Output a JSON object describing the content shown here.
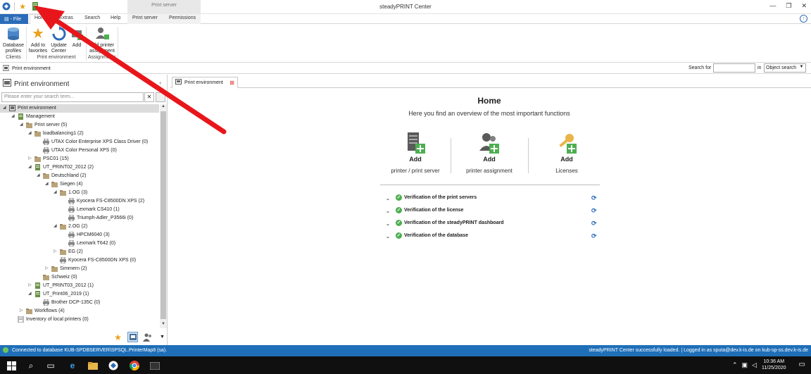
{
  "window": {
    "title": "steadyPRINT Center"
  },
  "context_tab_group": "Print server",
  "ribbon_tabs": {
    "file": "File",
    "home": "Home",
    "extras": "Extras",
    "search": "Search",
    "help": "Help",
    "print_server": "Print server",
    "permissions": "Permissions"
  },
  "ribbon": {
    "database_profiles": "Database profiles",
    "add_to_favorites": "Add to favorites",
    "update_center": "Update Center",
    "add": "Add",
    "add_printer_assignment": "Add printer assignment",
    "group_clients": "Clients",
    "group_print_environment": "Print environment",
    "group_assignments": "Assignments"
  },
  "breadcrumb": {
    "item": "Print environment"
  },
  "search_bar": {
    "search_for": "Search for",
    "in": "in",
    "object_search": "Object search"
  },
  "left_panel": {
    "title": "Print environment",
    "search_placeholder": "Please enter your search term...",
    "tree": [
      {
        "label": "Print environment",
        "level": 0,
        "exp": "◢",
        "icon": "environment",
        "selected": true
      },
      {
        "label": "Management",
        "level": 1,
        "exp": "◢",
        "icon": "server"
      },
      {
        "label": "Print server (5)",
        "level": 2,
        "exp": "◢",
        "icon": "folder"
      },
      {
        "label": "loadbalancing1 (2)",
        "level": 3,
        "exp": "◢",
        "icon": "folder"
      },
      {
        "label": "UTAX Color Enterprise XPS Class Driver (0)",
        "level": 4,
        "exp": "",
        "icon": "printer"
      },
      {
        "label": "UTAX Color Personal XPS (0)",
        "level": 4,
        "exp": "",
        "icon": "printer"
      },
      {
        "label": "PSC01 (15)",
        "level": 3,
        "exp": "▷",
        "icon": "folder"
      },
      {
        "label": "UT_PRINT02_2012 (2)",
        "level": 3,
        "exp": "◢",
        "icon": "server"
      },
      {
        "label": "Deutschland (2)",
        "level": 4,
        "exp": "◢",
        "icon": "folder"
      },
      {
        "label": "Siegen (4)",
        "level": 5,
        "exp": "◢",
        "icon": "folder"
      },
      {
        "label": "1.OG (3)",
        "level": 6,
        "exp": "◢",
        "icon": "folder"
      },
      {
        "label": "Kyocera FS-C8500DN XPS (2)",
        "level": 7,
        "exp": "",
        "icon": "printer"
      },
      {
        "label": "Lexmark CS410 (1)",
        "level": 7,
        "exp": "",
        "icon": "printer"
      },
      {
        "label": "Triumph-Adler_P3566i (0)",
        "level": 7,
        "exp": "",
        "icon": "printer"
      },
      {
        "label": "2.OG (2)",
        "level": 6,
        "exp": "◢",
        "icon": "folder"
      },
      {
        "label": "HPCM6040 (3)",
        "level": 7,
        "exp": "",
        "icon": "printer"
      },
      {
        "label": "Lexmark T642 (0)",
        "level": 7,
        "exp": "",
        "icon": "printer"
      },
      {
        "label": "EG (2)",
        "level": 6,
        "exp": "▷",
        "icon": "folder"
      },
      {
        "label": "Kyocera FS-C8500DN XPS (0)",
        "level": 6,
        "exp": "",
        "icon": "printer"
      },
      {
        "label": "Simmern (2)",
        "level": 5,
        "exp": "▷",
        "icon": "folder"
      },
      {
        "label": "Schweiz (0)",
        "level": 4,
        "exp": "",
        "icon": "folder"
      },
      {
        "label": "UT_PRINT03_2012 (1)",
        "level": 3,
        "exp": "▷",
        "icon": "server"
      },
      {
        "label": "UT_Print06_2019 (1)",
        "level": 3,
        "exp": "◢",
        "icon": "server"
      },
      {
        "label": "Brother DCP-135C (0)",
        "level": 4,
        "exp": "",
        "icon": "printer"
      },
      {
        "label": "Workflows (4)",
        "level": 2,
        "exp": "▷",
        "icon": "folder"
      },
      {
        "label": "Inventory of local printers (0)",
        "level": 1,
        "exp": "",
        "icon": "doc"
      }
    ]
  },
  "doc_tab": {
    "label": "Print environment"
  },
  "home": {
    "title": "Home",
    "subtitle": "Here you find an overview of the most important functions",
    "cards": [
      {
        "add": "Add",
        "label": "printer / print server"
      },
      {
        "add": "Add",
        "label": "printer assignment"
      },
      {
        "add": "Add",
        "label": "Licenses"
      }
    ],
    "verifications": [
      "Verification of the print servers",
      "Verification of the license",
      "Verification of the steadyPRINT dashboard",
      "Verification of the database"
    ]
  },
  "status": {
    "left": "Connected to database KUB-SPDBSERVER\\SPSQL.PrinterMap8 (sa).",
    "right": "steadyPRINT Center successfully loaded. | Logged in as sputa@dev.k-is.de on kub-sp-ss.dev.k-is.de"
  },
  "taskbar": {
    "time": "10:36 AM",
    "date": "11/25/2020"
  },
  "colors": {
    "accent": "#1f6fb8",
    "arrow": "#e8161b",
    "check": "#4caf50"
  }
}
